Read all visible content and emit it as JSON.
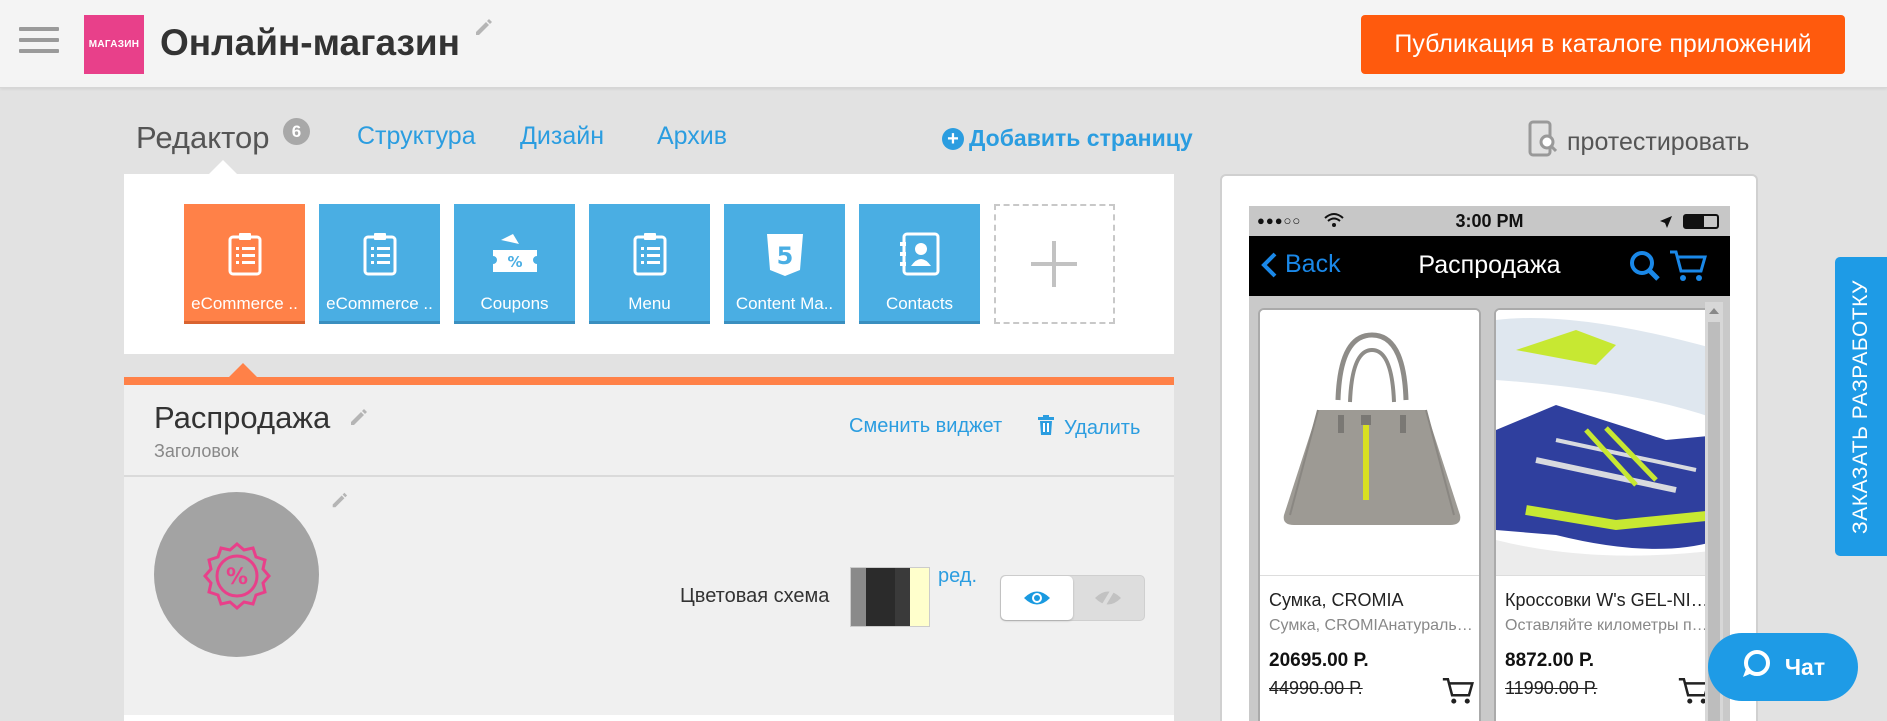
{
  "header": {
    "logo_text": "МАГАЗИН",
    "app_title": "Онлайн-магазин",
    "publish_label": "Публикация в каталоге приложений",
    "logo_color": "#e8408a",
    "publish_color": "#ff5a0d"
  },
  "tabs": {
    "editor": "Редактор",
    "editor_badge": "6",
    "structure": "Структура",
    "design": "Дизайн",
    "archive": "Архив",
    "add_page": "Добавить страницу",
    "test": "протестировать"
  },
  "widgets": [
    {
      "label": "eCommerce ..",
      "icon": "clipboard-icon",
      "active": true
    },
    {
      "label": "eCommerce ..",
      "icon": "clipboard-icon",
      "active": false
    },
    {
      "label": "Coupons",
      "icon": "coupon-icon",
      "active": false
    },
    {
      "label": "Menu",
      "icon": "clipboard-icon",
      "active": false
    },
    {
      "label": "Content Ma..",
      "icon": "html5-icon",
      "active": false
    },
    {
      "label": "Contacts",
      "icon": "contacts-icon",
      "active": false
    }
  ],
  "section": {
    "title": "Распродажа",
    "subtitle": "Заголовок",
    "change_widget": "Сменить виджет",
    "delete": "Удалить",
    "color_scheme_label": "Цветовая схема",
    "color_edit": "ред.",
    "scheme_colors": [
      "#8a8a8a",
      "#2b2b2b",
      "#3a3a3a",
      "#ffffcc"
    ],
    "accent_color": "#ff8148"
  },
  "preview": {
    "time": "3:00 PM",
    "back": "Back",
    "title": "Распродажа",
    "products": [
      {
        "name": "Сумка, CROMIA",
        "desc": "Сумка, CROMIAнатуральная кожа",
        "price": "20695.00 Р.",
        "old_price": "44990.00 Р."
      },
      {
        "name": "Кроссовки W's GEL-NIMBUS",
        "desc": "Оставляйте километры позади",
        "price": "8872.00 Р.",
        "old_price": "11990.00 Р."
      }
    ]
  },
  "side_tab": "ЗАКАЗАТЬ РАЗРАБОТКУ",
  "chat": "Чат"
}
